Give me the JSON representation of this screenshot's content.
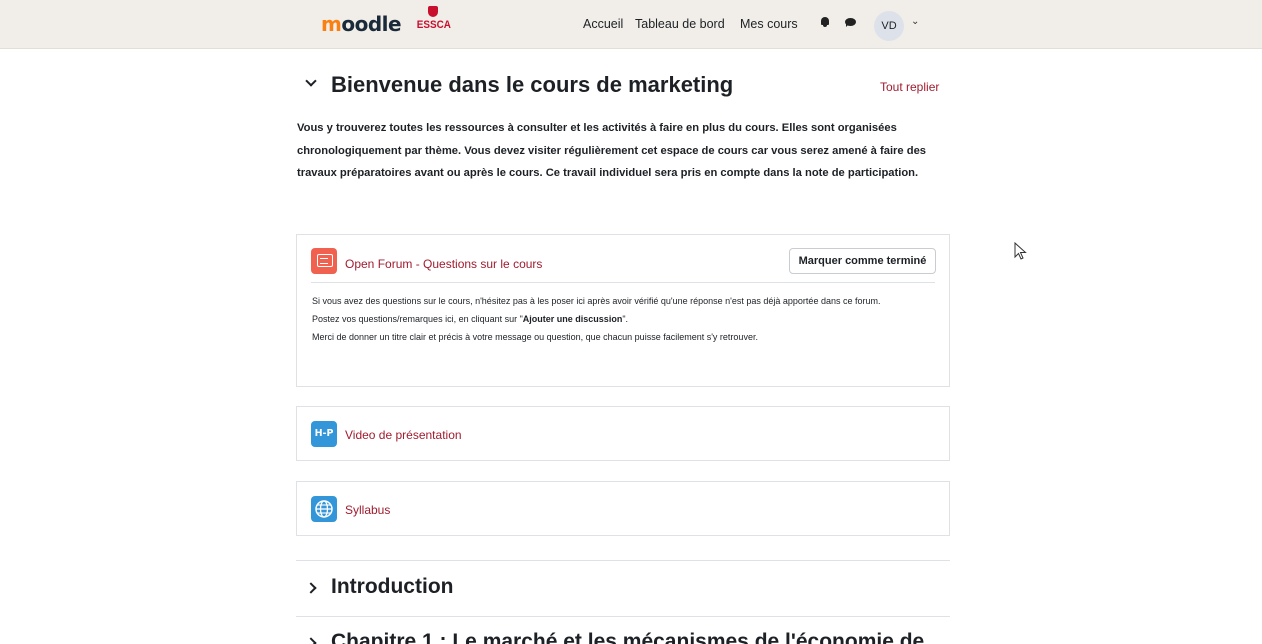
{
  "navbar": {
    "logo_text": "moodle",
    "school_logo_text": "ESSCA",
    "links": [
      "Accueil",
      "Tableau de bord",
      "Mes cours"
    ],
    "avatar_initials": "VD"
  },
  "section": {
    "title": "Bienvenue dans le cours de marketing",
    "collapse_all_label": "Tout replier",
    "summary": "Vous y trouverez toutes les ressources à consulter et les activités à faire en plus du cours. Elles sont organisées chronologiquement par thème. Vous devez visiter régulièrement cet espace de cours car vous serez amené à faire des travaux préparatoires avant ou après le cours. Ce travail individuel sera pris en compte dans la note de participation."
  },
  "activities": [
    {
      "title": "Open Forum - Questions sur le cours",
      "icon": "forum-icon",
      "completion_button": "Marquer comme terminé",
      "description": {
        "line1": "Si vous avez des questions sur le cours, n'hésitez pas à les poser ici après avoir vérifié qu'une réponse n'est pas déjà apportée dans ce forum.",
        "line2_prefix": "Postez vos questions/remarques ici, en cliquant sur \"",
        "line2_bold": "Ajouter une discussion",
        "line2_suffix": "\".",
        "line3": "Merci de donner un titre clair et précis à votre message ou question, que chacun puisse facilement s'y retrouver."
      }
    },
    {
      "title": "Video de présentation",
      "icon": "h5p-icon",
      "icon_text": "H-P"
    },
    {
      "title": "Syllabus",
      "icon": "globe-icon"
    }
  ],
  "sections_collapsed": [
    {
      "title": "Introduction"
    },
    {
      "title": "Chapitre 1 : Le marché et les mécanismes de l'économie de"
    }
  ],
  "colors": {
    "navbar_bg": "#f1eee9",
    "link_accent": "#a01c2f",
    "forum_icon": "#f0614f",
    "resource_icon": "#3296d9"
  }
}
